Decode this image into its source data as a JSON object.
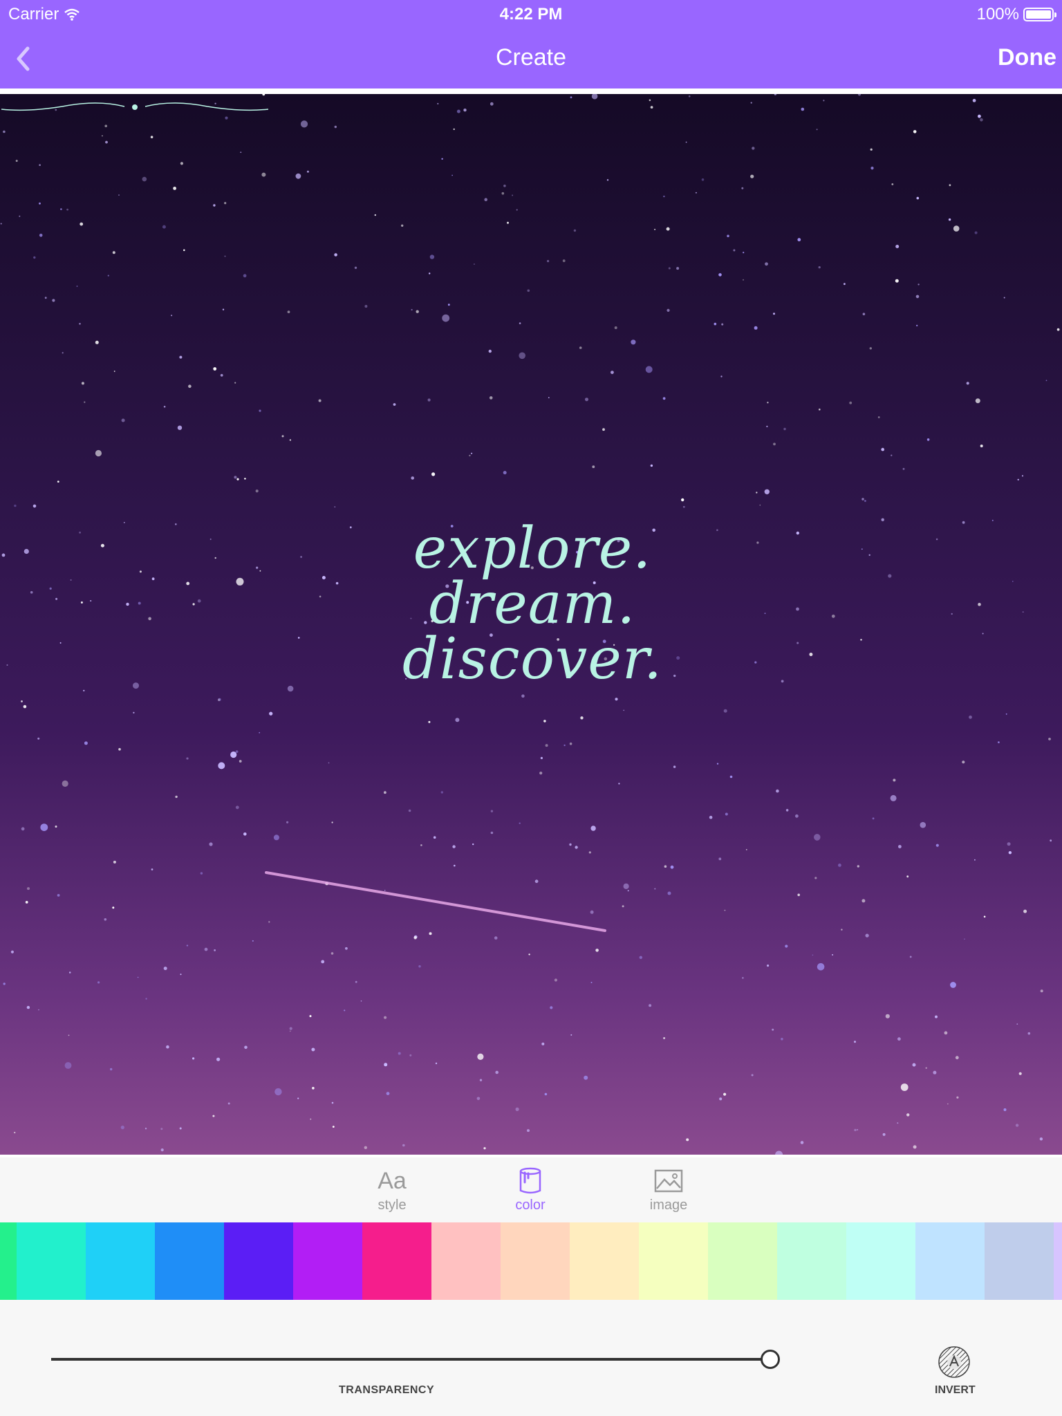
{
  "status_bar": {
    "carrier": "Carrier",
    "time": "4:22 PM",
    "battery": "100%"
  },
  "nav": {
    "title": "Create",
    "done_label": "Done"
  },
  "canvas": {
    "quote_lines": [
      "explore.",
      "dream.",
      "discover."
    ],
    "text_color": "#b9f3e4"
  },
  "tools": [
    {
      "label": "style",
      "icon": "text-style-icon"
    },
    {
      "label": "color",
      "icon": "paint-bucket-icon",
      "active": true
    },
    {
      "label": "image",
      "icon": "image-icon"
    }
  ],
  "swatches": [
    "#24f08c",
    "#22f0cc",
    "#1fd0f7",
    "#1f8ef7",
    "#5b1ef5",
    "#b21ef5",
    "#f51e8c",
    "#ffc1c1",
    "#ffd6bd",
    "#ffedbf",
    "#f5ffbf",
    "#d9ffbf",
    "#bfffe0",
    "#bffff5",
    "#bfe3ff",
    "#bfcdeb",
    "#d7c4ff"
  ],
  "selected_swatch": "#bfffe0",
  "transparency": {
    "label": "TRANSPARENCY",
    "value": 1.0
  },
  "invert": {
    "label": "INVERT"
  },
  "accent": "#9966ff"
}
